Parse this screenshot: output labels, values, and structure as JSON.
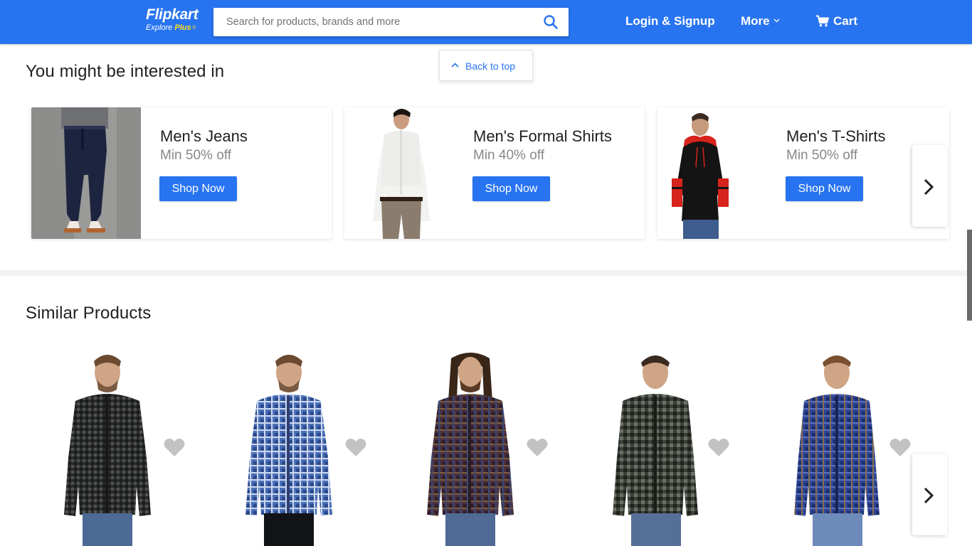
{
  "header": {
    "logo": "Flipkart",
    "logo_sub_prefix": "Explore",
    "logo_sub_plus": "Plus",
    "search_placeholder": "Search for products, brands and more",
    "login_label": "Login & Signup",
    "more_label": "More",
    "cart_label": "Cart",
    "colors": {
      "brand": "#2874f0",
      "accent": "#ffe11b"
    }
  },
  "back_to_top": {
    "label": "Back to top"
  },
  "interested": {
    "title": "You might be interested in",
    "cards": [
      {
        "title": "Men's Jeans",
        "offer": "Min 50% off",
        "button": "Shop Now",
        "image": "jeans-model"
      },
      {
        "title": "Men's Formal Shirts",
        "offer": "Min 40% off",
        "button": "Shop Now",
        "image": "formal-shirt-model"
      },
      {
        "title": "Men's T-Shirts",
        "offer": "Min 50% off",
        "button": "Shop Now",
        "image": "hoodie-tshirt-model"
      }
    ]
  },
  "similar": {
    "title": "Similar Products",
    "products": [
      {
        "image": "black-check-shirt",
        "color": "#2e2f30"
      },
      {
        "image": "blue-check-shirt",
        "color": "#4a6fb8"
      },
      {
        "image": "maroon-check-shirt",
        "color": "#4b3040"
      },
      {
        "image": "green-check-shirt",
        "color": "#3b4038"
      },
      {
        "image": "navy-check-shirt",
        "color": "#2f4592"
      }
    ]
  }
}
